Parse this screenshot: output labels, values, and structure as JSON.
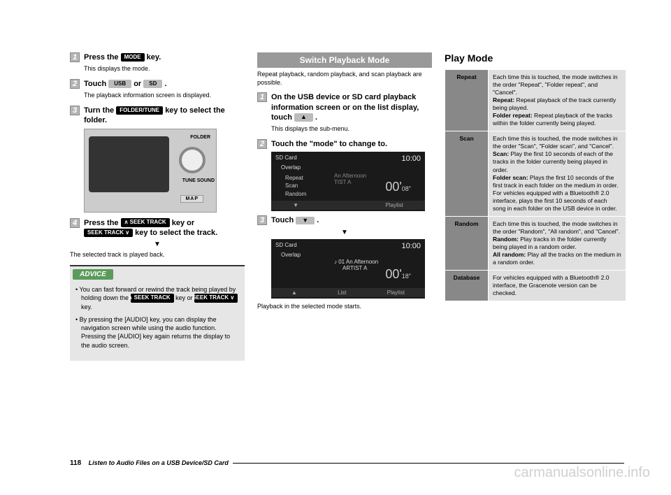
{
  "col1": {
    "step1": {
      "num": "1",
      "text_a": "Press the ",
      "key": "MODE",
      "text_b": " key.",
      "sub": "This displays the mode."
    },
    "step2": {
      "num": "2",
      "text_a": "Touch ",
      "key1": "USB",
      "text_or": " or ",
      "key2": "SD",
      "text_b": " .",
      "sub": "The playback information screen is displayed."
    },
    "step3": {
      "num": "3",
      "text_a": "Turn the ",
      "key": "FOLDER/TUNE",
      "text_b": " key to select the folder."
    },
    "diagram": {
      "folder": "FOLDER",
      "tune": "TUNE SOUND",
      "map": "MAP"
    },
    "step4": {
      "num": "4",
      "text_a": "Press the ",
      "key1": "∧ SEEK TRACK",
      "text_mid": " key or ",
      "key2": "SEEK TRACK ∨",
      "text_b": " key to select the track."
    },
    "after4": "The selected track is played back.",
    "advice_label": "ADVICE",
    "advice1_a": "You can fast forward or rewind the track being played by holding down the ",
    "advice1_k1": "∧ SEEK TRACK",
    "advice1_mid": " key or ",
    "advice1_k2": "SEEK TRACK ∨",
    "advice1_b": " key.",
    "advice2": "By pressing the [AUDIO] key, you can display the navigation screen while using the audio function. Pressing the [AUDIO] key again returns the display to the audio screen."
  },
  "col2": {
    "header": "Switch Playback Mode",
    "intro": "Repeat playback, random playback, and scan playback are possible.",
    "step1": {
      "num": "1",
      "text": "On the USB device or SD card playback information screen or on the list display, touch ",
      "btn": "▲",
      "after": " .",
      "sub": "This displays the sub-menu."
    },
    "step2": {
      "num": "2",
      "text": "Touch the \"mode\" to change to."
    },
    "ss1": {
      "title": "SD Card",
      "time": "10:00",
      "sub": "Overlap",
      "menu1": "Repeat",
      "menu2": "Scan",
      "menu3": "Random",
      "center1": "An Afternoon",
      "center2": "TIST A",
      "big": "00'",
      "big_s": "08\"",
      "bottom_r": "Playlist"
    },
    "step3": {
      "num": "3",
      "text": "Touch ",
      "btn": "▼",
      "after": " ."
    },
    "ss2": {
      "title": "SD Card",
      "time": "10:00",
      "sub": "Overlap",
      "play1": "♪ 01  An Afternoon",
      "play2": "ARTIST A",
      "big": "00'",
      "big_s": "18\"",
      "b1": "▲",
      "b2": "List",
      "b3": "Playlist"
    },
    "outro": "Playback in the selected mode starts."
  },
  "col3": {
    "heading": "Play Mode",
    "rows": [
      {
        "label": "Repeat",
        "desc_a": "Each time this is touched, the mode switches in the order \"Repeat\", \"Folder repeat\", and \"Cancel\".",
        "b1": "Repeat:",
        "d1": "  Repeat playback of the track currently being played.",
        "b2": "Folder repeat:",
        "d2": "  Repeat playback of the tracks within the folder currently being played."
      },
      {
        "label": "Scan",
        "desc_a": "Each time this is touched, the mode switches in the order \"Scan\", \"Folder scan\", and \"Cancel\".",
        "b1": "Scan:",
        "d1": "  Play the first 10 seconds of each of the tracks in the folder currently being played in order.",
        "b2": "Folder scan:",
        "d2": " Plays the first 10 seconds of the first track in each folder on the medium in order. For vehicles equipped with a Bluetooth® 2.0 interface, plays the first 10 seconds of each song in each folder on the USB device in order."
      },
      {
        "label": "Random",
        "desc_a": "Each time this is touched, the mode switches in the order \"Random\", \"All random\", and \"Cancel\".",
        "b1": "Random:",
        "d1": "  Play tracks in the folder currently being played in a random order.",
        "b2": "All random:",
        "d2": "  Play all the tracks on the medium in a random order."
      },
      {
        "label": "Database",
        "desc_a": "For vehicles equipped with a Bluetooth® 2.0 interface, the Gracenote version can be checked."
      }
    ]
  },
  "footer": {
    "page": "118",
    "title": "Listen to Audio Files on a USB Device/SD Card"
  },
  "watermark": "carmanualsonline.info",
  "triangle": "▼"
}
